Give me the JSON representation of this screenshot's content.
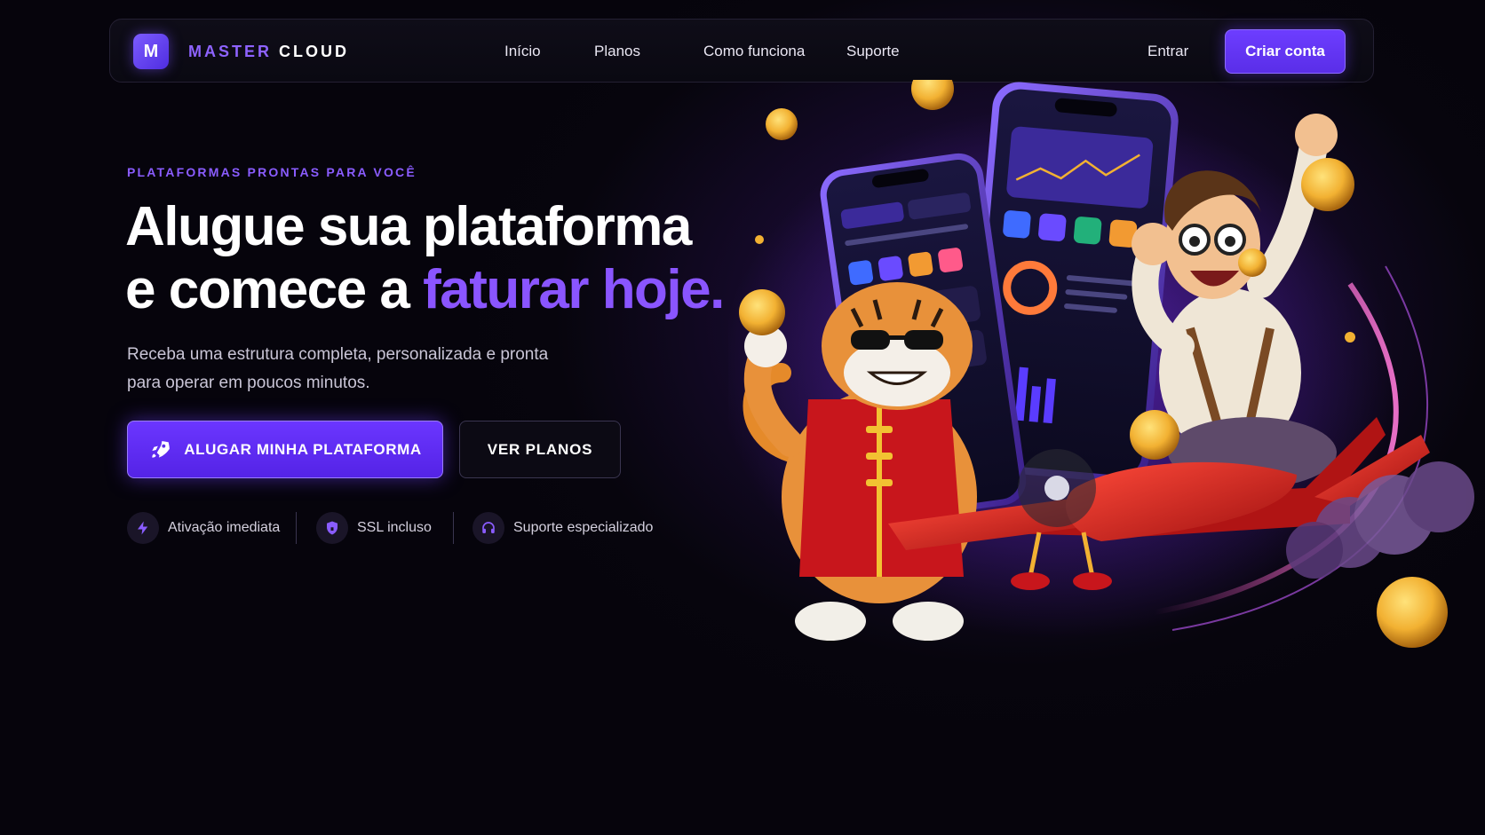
{
  "brand": {
    "logo_letter": "M",
    "word1": "MASTER",
    "word2": "CLOUD"
  },
  "nav": {
    "links": [
      "Início",
      "Planos",
      "Como funciona",
      "Suporte"
    ],
    "login": "Entrar",
    "signup": "Criar conta"
  },
  "hero": {
    "eyebrow": "PLATAFORMAS PRONTAS PARA VOCÊ",
    "title_line1": "Alugue sua plataforma",
    "title_line2_plain": "e comece a ",
    "title_line2_accent": "faturar hoje.",
    "subtitle_line1": "Receba uma estrutura completa, personalizada e pronta",
    "subtitle_line2": "para operar em poucos minutos.",
    "primary_cta": "ALUGAR MINHA PLATAFORMA",
    "secondary_cta": "VER PLANOS"
  },
  "features": [
    {
      "icon": "lightning-icon",
      "label": "Ativação imediata"
    },
    {
      "icon": "shield-icon",
      "label": "SSL incluso"
    },
    {
      "icon": "headset-icon",
      "label": "Suporte especializado"
    }
  ],
  "colors": {
    "accent": "#7c4dff",
    "background": "#06040c",
    "gold": "#f2b132"
  }
}
